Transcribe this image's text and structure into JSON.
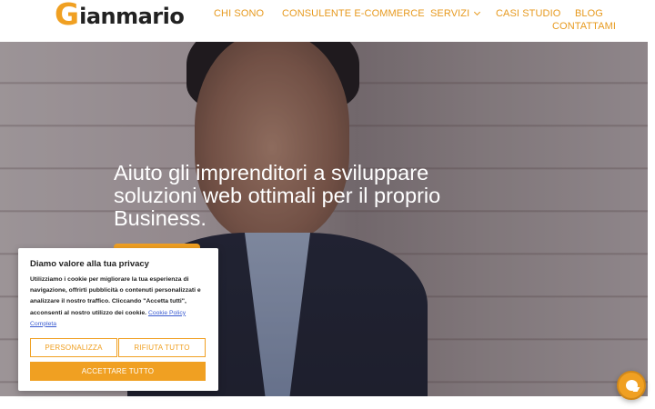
{
  "logo": {
    "initial": "G",
    "rest": "ianmario"
  },
  "nav": {
    "items": [
      {
        "label": "CHI SONO"
      },
      {
        "label": "CONSULENTE E-COMMERCE"
      },
      {
        "label": "SERVIZI"
      },
      {
        "label": "CASI STUDIO"
      },
      {
        "label": "BLOG"
      },
      {
        "label": "CONTATTAMI"
      }
    ]
  },
  "hero": {
    "title": "Aiuto gli imprenditori a sviluppare soluzioni web ottimali per il proprio Business."
  },
  "cookie": {
    "title": "Diamo valore alla tua privacy",
    "text": "Utilizziamo i cookie per migliorare la tua esperienza di navigazione, offrirti pubblicità o contenuti personalizzati e analizzare il nostro traffico. Cliccando \"Accetta tutti\", acconsenti al nostro utilizzo dei cookie.",
    "link": "Cookie Policy Completa",
    "customize_label": "PERSONALIZZA",
    "reject_label": "RIFIUTA TUTTO",
    "accept_label": "ACCETTARE TUTTO"
  },
  "colors": {
    "accent": "#f0a022",
    "text_dark": "#222222",
    "link": "#3a5bd0"
  },
  "icons": {
    "nav_dropdown": "chevron-down-icon",
    "chat": "chat-icon"
  }
}
